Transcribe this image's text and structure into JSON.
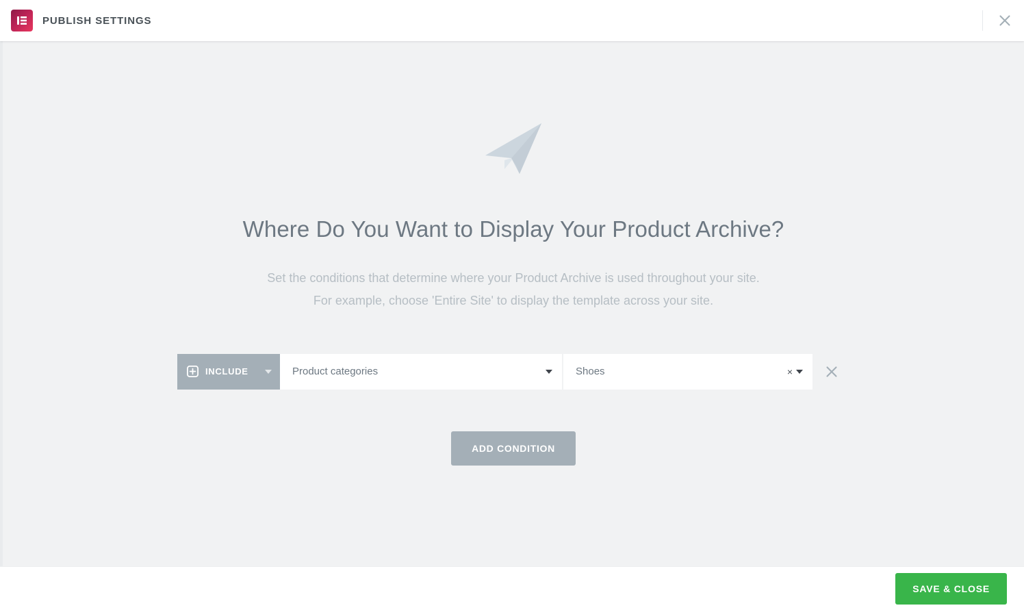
{
  "header": {
    "title": "PUBLISH SETTINGS",
    "logo_icon": "elementor-logo-icon",
    "close_icon": "close-icon",
    "brand_color": "#e8365d"
  },
  "main": {
    "hero_icon": "paper-plane-icon",
    "headline": "Where Do You Want to Display Your Product Archive?",
    "description_line1": "Set the conditions that determine where your Product Archive is used throughout your site.",
    "description_line2": "For example, choose 'Entire Site' to display the template across your site.",
    "conditions": [
      {
        "include_label": "INCLUDE",
        "include_icon": "plus-square-icon",
        "include_caret_icon": "chevron-down-icon",
        "field_name": "Product categories",
        "field_name_caret_icon": "caret-down-icon",
        "field_value": "Shoes",
        "field_value_clear_icon": "×",
        "field_value_caret_icon": "caret-down-icon",
        "remove_icon": "close-icon"
      }
    ],
    "add_condition_label": "ADD CONDITION"
  },
  "footer": {
    "save_label": "SAVE & CLOSE",
    "save_color": "#39b54a"
  }
}
